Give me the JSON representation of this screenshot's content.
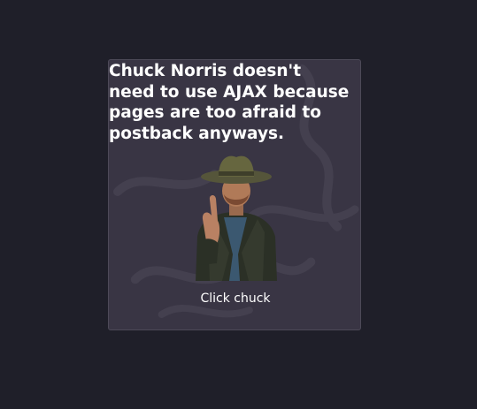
{
  "joke": {
    "text": "Chuck Norris doesn't need to use AJAX because pages are too afraid to postback anyways."
  },
  "image": {
    "icon": "chuck-norris-pointing-icon"
  },
  "button": {
    "label": "Click chuck"
  },
  "colors": {
    "page_background": "#1f1f29",
    "card_background": "#393544",
    "text": "#ffffff"
  }
}
